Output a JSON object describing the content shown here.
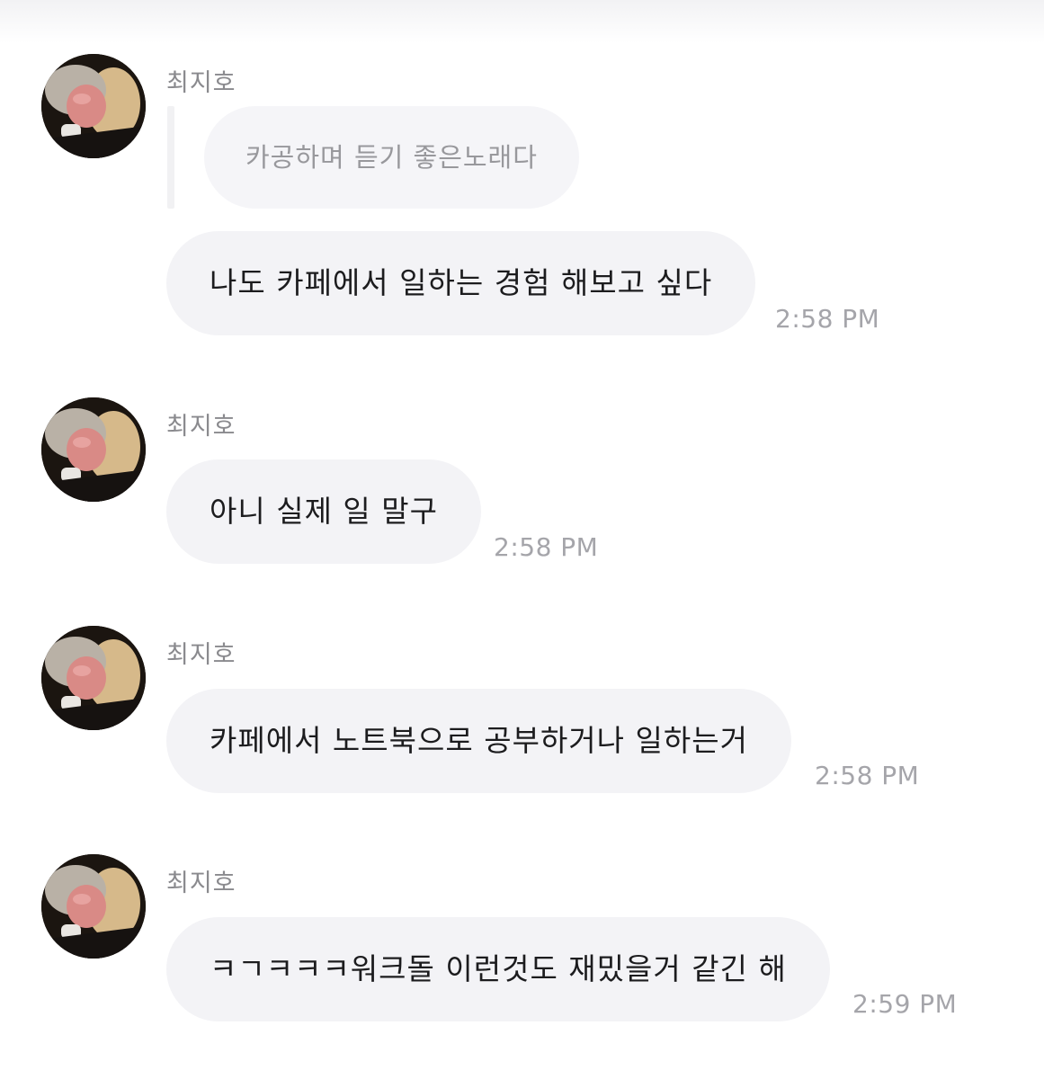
{
  "messages": [
    {
      "sender": "최지호",
      "quoted": "카공하며 듣기 좋은노래다",
      "text": "나도 카페에서 일하는 경험 해보고 싶다",
      "time": "2:58 PM"
    },
    {
      "sender": "최지호",
      "text": "아니 실제 일 말구",
      "time": "2:58 PM"
    },
    {
      "sender": "최지호",
      "text": "카페에서 노트북으로 공부하거나 일하는거",
      "time": "2:58 PM"
    },
    {
      "sender": "최지호",
      "text": "ㅋㄱㅋㅋㅋ워크돌 이런것도 재밌을거 같긴 해",
      "time": "2:59 PM"
    }
  ],
  "colors": {
    "bubble": "#f3f3f6",
    "sender": "#8a8a8e",
    "time": "#a5a5aa",
    "text": "#1c1c1e"
  }
}
